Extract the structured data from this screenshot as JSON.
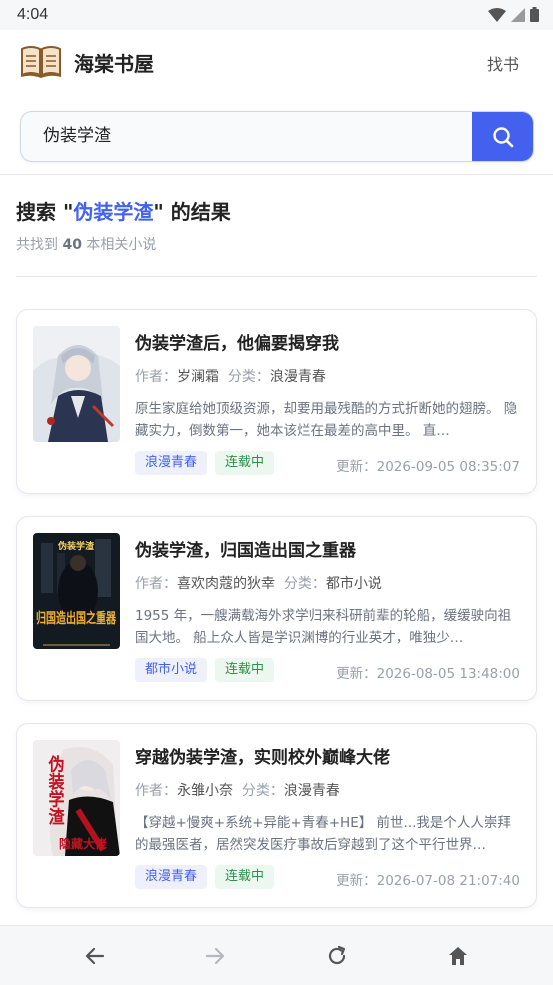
{
  "status_bar": {
    "time": "4:04"
  },
  "header": {
    "app_title": "海棠书屋",
    "find_link": "找书",
    "logo_icon": "open-book-icon"
  },
  "search": {
    "query": "伪装学渣",
    "button_icon": "search-icon"
  },
  "results": {
    "title_prefix": "搜索 \"",
    "title_keyword": "伪装学渣",
    "title_suffix": "\" 的结果",
    "count_prefix": "共找到 ",
    "count": "40",
    "count_suffix": " 本相关小说"
  },
  "books": [
    {
      "title": "伪装学渣后，他偏要揭穿我",
      "author_label": "作者：",
      "author": "岁澜霜",
      "category_label": "分类：",
      "category": "浪漫青春",
      "description": "原生家庭给她顶级资源，却要用最残酷的方式折断她的翅膀。 隐藏实力，倒数第一，她本该烂在最差的高中里。 直…",
      "tag_category": "浪漫青春",
      "tag_status": "连载中",
      "update_label": "更新：",
      "update_time": "2026-09-05 08:35:07"
    },
    {
      "title": "伪装学渣，归国造出国之重器",
      "author_label": "作者：",
      "author": "喜欢肉蔻的狄幸",
      "category_label": "分类：",
      "category": "都市小说",
      "description": "1955 年，一艘满载海外求学归来科研前辈的轮船，缓缓驶向祖国大地。 船上众人皆是学识渊博的行业英才，唯独少…",
      "tag_category": "都市小说",
      "tag_status": "连载中",
      "update_label": "更新：",
      "update_time": "2026-08-05 13:48:00",
      "cover_text_top": "伪装学渣",
      "cover_text_main": "归国造出国之重器"
    },
    {
      "title": "穿越伪装学渣，实则校外巅峰大佬",
      "author_label": "作者：",
      "author": "永雏小奈",
      "category_label": "分类：",
      "category": "浪漫青春",
      "description": "【穿越+慢爽+系统+异能+青春+HE】 前世...我是个人人崇拜的最强医者，居然突发医疗事故后穿越到了这个平行世界…",
      "tag_category": "浪漫青春",
      "tag_status": "连载中",
      "update_label": "更新：",
      "update_time": "2026-07-08 21:07:40",
      "cover_text_main": "伪装学渣",
      "cover_text_sub": "隐藏大佬"
    }
  ],
  "nav": {
    "back_icon": "arrow-left-icon",
    "forward_icon": "arrow-right-icon",
    "reload_icon": "reload-icon",
    "home_icon": "home-icon"
  },
  "colors": {
    "accent": "#4361ee",
    "status_green": "#2f8f4a"
  }
}
